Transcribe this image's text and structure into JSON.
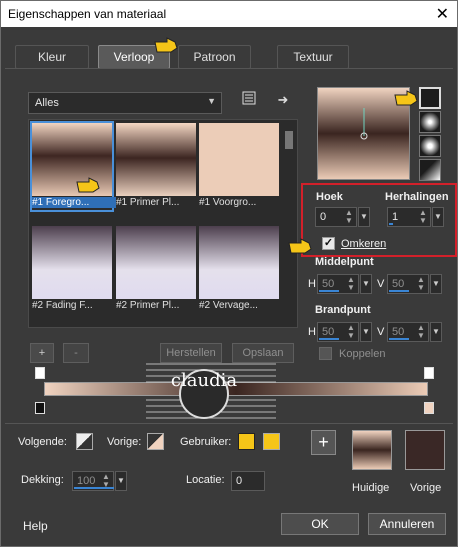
{
  "window": {
    "title": "Eigenschappen van materiaal",
    "close_glyph": "✕"
  },
  "tabs": [
    {
      "label": "Kleur"
    },
    {
      "label": "Verloop"
    },
    {
      "label": "Patroon"
    },
    {
      "label": "Textuur"
    }
  ],
  "filter": {
    "value": "Alles"
  },
  "gallery": {
    "items": [
      {
        "label": "#1 Foregro..."
      },
      {
        "label": "#1 Primer Pl..."
      },
      {
        "label": "#1 Voorgro..."
      },
      {
        "label": "#2 Fading F..."
      },
      {
        "label": "#2 Primer Pl..."
      },
      {
        "label": "#2 Vervage..."
      }
    ]
  },
  "gallery_buttons": {
    "add": "+",
    "remove": "-",
    "restore": "Herstellen",
    "save": "Opslaan"
  },
  "settings": {
    "angle_label": "Hoek",
    "angle_value": "0",
    "repeats_label": "Herhalingen",
    "repeats_value": "1",
    "invert_label": "Omkeren",
    "invert_checked": true,
    "center_label": "Middelpunt",
    "center_h_label": "H",
    "center_h_value": "50",
    "center_v_label": "V",
    "center_v_value": "50",
    "focus_label": "Brandpunt",
    "focus_h_label": "H",
    "focus_h_value": "50",
    "focus_v_label": "V",
    "focus_v_value": "50",
    "link_label": "Koppelen"
  },
  "bottom": {
    "next_label": "Volgende:",
    "prev_label": "Vorige:",
    "user_label": "Gebruiker:",
    "opacity_label": "Dekking:",
    "opacity_value": "100",
    "location_label": "Locatie:",
    "location_value": "0",
    "current_label": "Huidige",
    "previous_label": "Vorige"
  },
  "footer": {
    "help": "Help",
    "ok": "OK",
    "cancel": "Annuleren"
  },
  "colors": {
    "accent": "#3a85d4",
    "highlight_box": "#d3202a",
    "gradient_light": "#f0d3c0",
    "gradient_dark": "#3a2520",
    "user_swatch": "#f5c518",
    "previous_swatch": "#3a2826"
  },
  "watermark": {
    "text": "claudia"
  }
}
